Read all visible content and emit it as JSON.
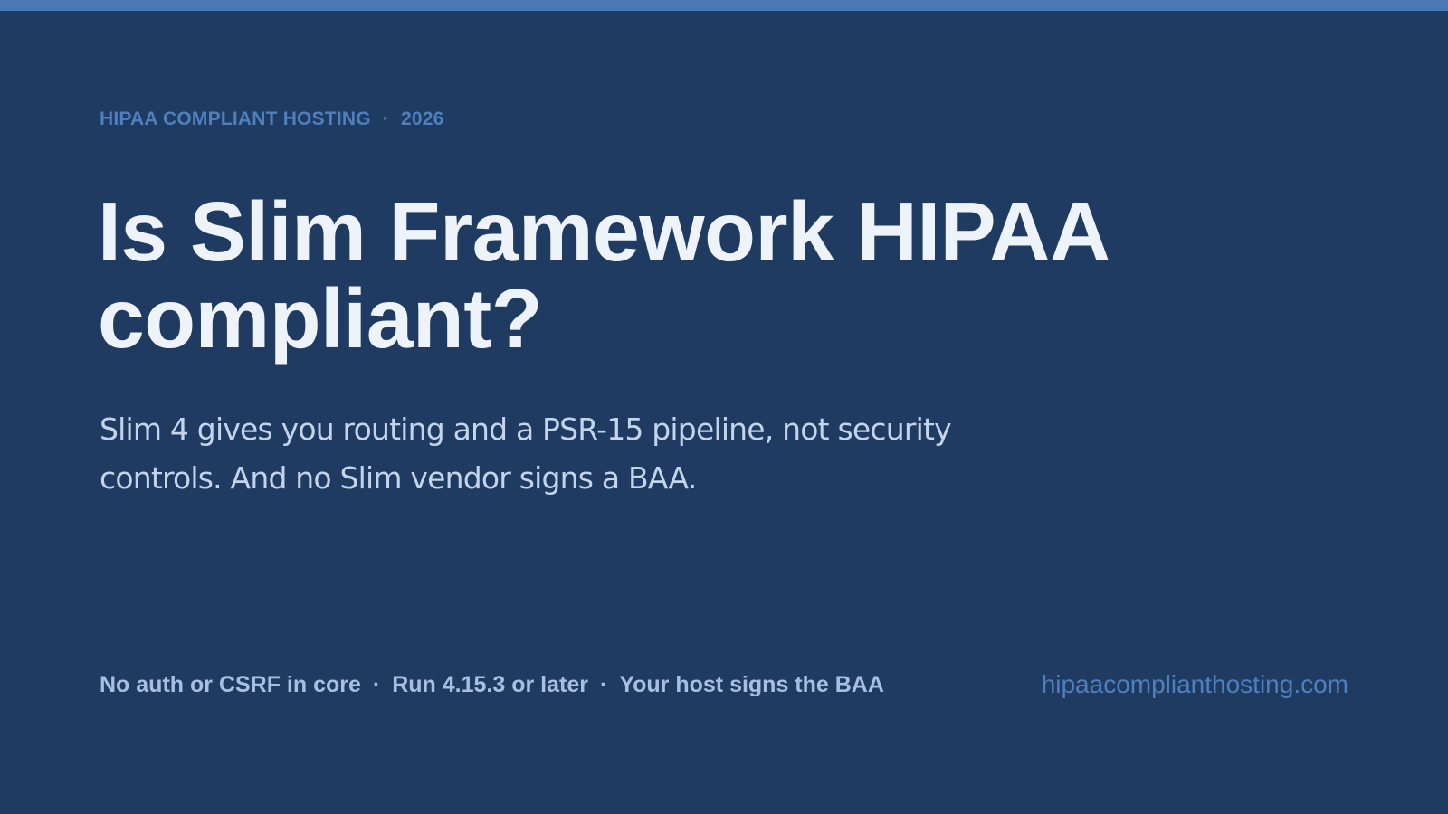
{
  "colors": {
    "background": "#1f3b61",
    "accent_bar": "#4a7ab5",
    "eyebrow": "#4f80bd",
    "headline": "#eef3fa",
    "subhead": "#c3d4ec",
    "footer_text": "#a7c0e1",
    "url": "#4f80bd"
  },
  "eyebrow": {
    "brand": "HIPAA COMPLIANT HOSTING",
    "separator": "·",
    "year": "2026"
  },
  "headline": "Is Slim Framework HIPAA compliant?",
  "subhead": "Slim 4 gives you routing and a PSR-15 pipeline, not security controls. And no Slim vendor signs a BAA.",
  "footer": {
    "points": [
      "No auth or CSRF in core",
      "Run 4.15.3 or later",
      "Your host signs the BAA"
    ],
    "separator": "·",
    "url": "hipaacomplianthosting.com"
  }
}
